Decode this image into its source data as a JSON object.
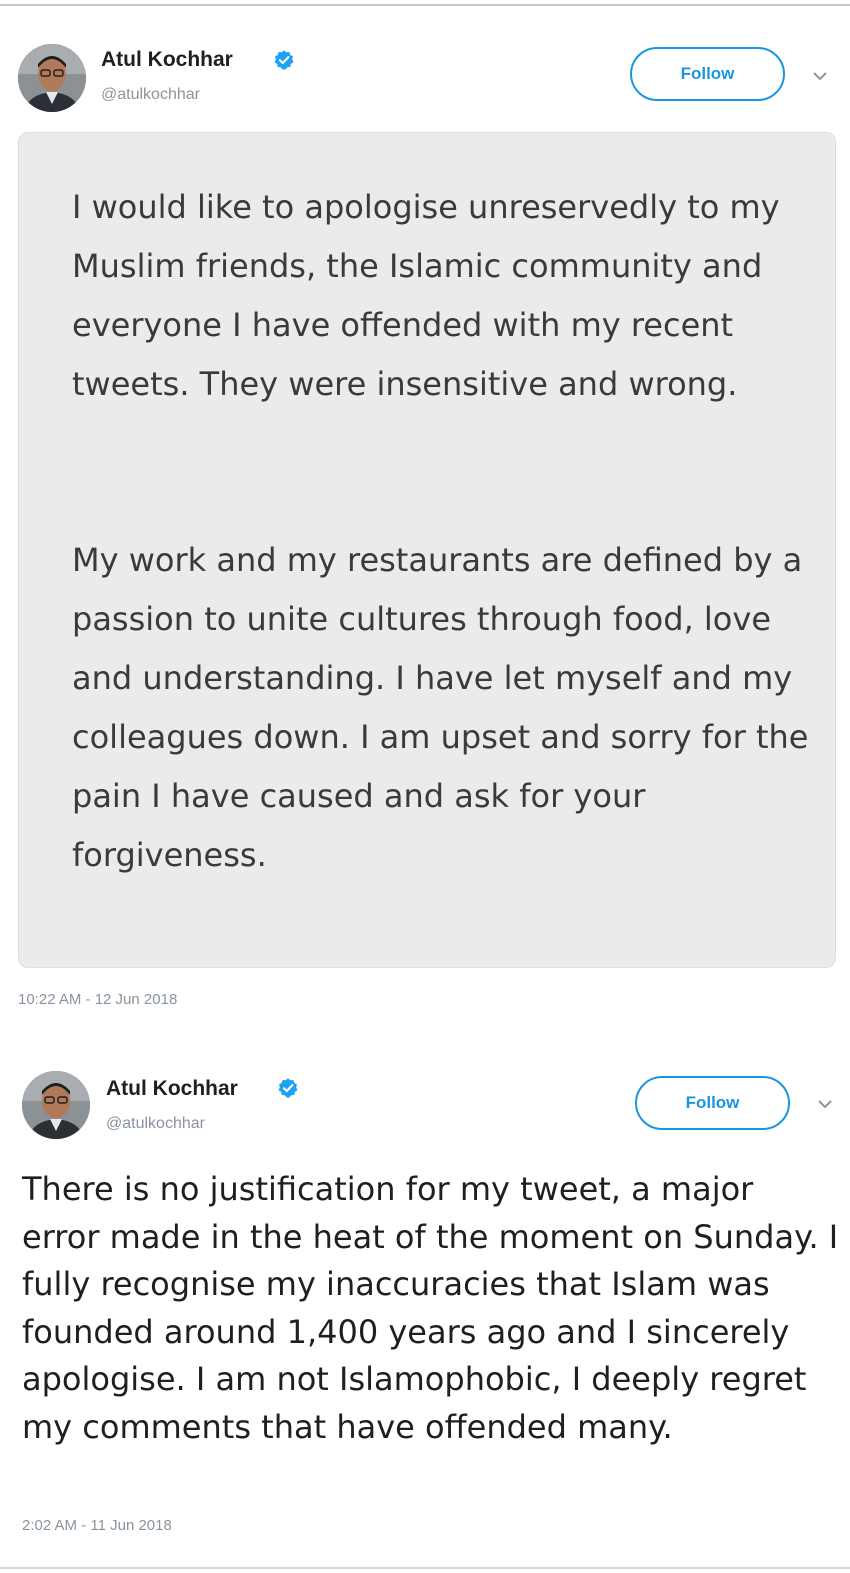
{
  "tweets": [
    {
      "author_name": "Atul Kochhar",
      "handle": "@atulkochhar",
      "follow_label": "Follow",
      "image_text": {
        "paragraph_1": "I would like to apologise unreservedly to my Muslim friends, the Islamic community and everyone I have offended with my recent tweets. They were insensitive and wrong.",
        "paragraph_2": "My work and my restaurants are defined by a passion to unite cultures through food, love and understanding. I have let myself and my colleagues down. I am upset and sorry for the pain I have caused and ask for your forgiveness."
      },
      "timestamp": "10:22 AM - 12 Jun 2018"
    },
    {
      "author_name": "Atul Kochhar",
      "handle": "@atulkochhar",
      "follow_label": "Follow",
      "text": "There is no justification for my tweet, a major error made in the heat of the moment on Sunday.  I fully recognise my inaccuracies that Islam was founded around 1,400 years ago and I sincerely apologise.  I am not Islamophobic, I deeply regret my comments that have offended many.",
      "timestamp": "2:02 AM - 11 Jun 2018"
    }
  ],
  "colors": {
    "accent": "#1b95e0",
    "text": "#1c2022",
    "muted": "#8a949e",
    "image_background": "#ebebeb"
  },
  "icons": [
    "verified-badge-icon",
    "chevron-down-icon",
    "avatar"
  ]
}
